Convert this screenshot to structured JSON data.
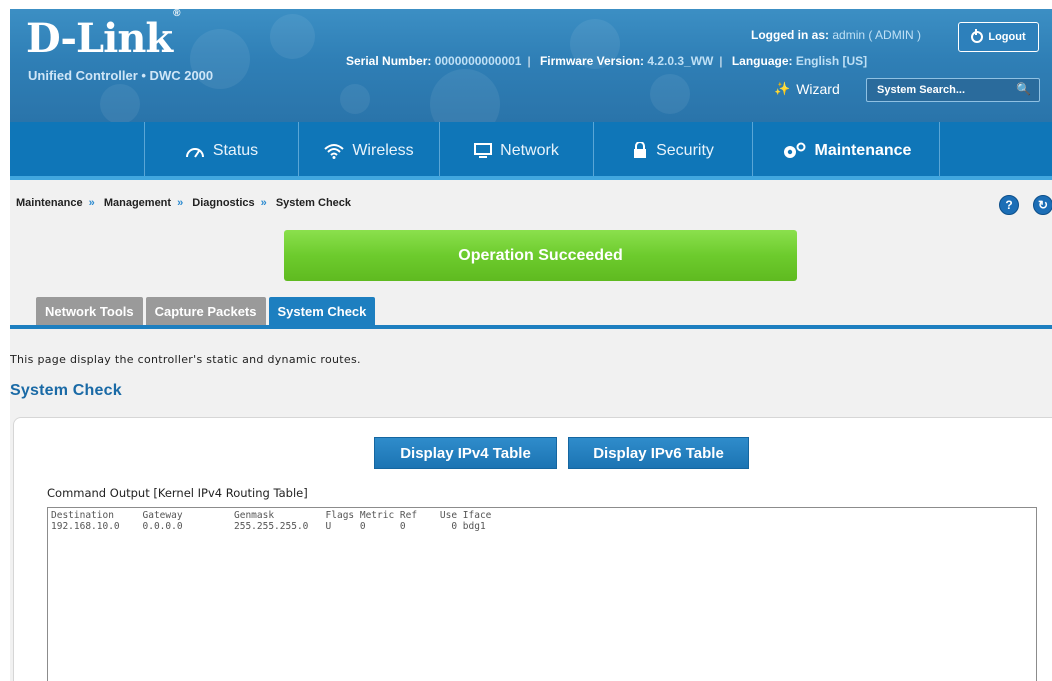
{
  "header": {
    "brand": "D-Link",
    "brand_mark": "®",
    "product": "Unified Controller • DWC 2000",
    "serial_label": "Serial Number:",
    "serial_value": "0000000000001",
    "firmware_label": "Firmware Version:",
    "firmware_value": "4.2.0.3_WW",
    "language_label": "Language:",
    "language_value": "English [US]",
    "logged_label": "Logged in as:",
    "logged_value": "admin ( ADMIN )",
    "logout_label": "Logout",
    "wizard_label": "Wizard",
    "search_placeholder": "System Search..."
  },
  "nav": {
    "items": [
      {
        "label": "Status",
        "icon": "gauge-icon"
      },
      {
        "label": "Wireless",
        "icon": "wifi-icon"
      },
      {
        "label": "Network",
        "icon": "monitor-icon"
      },
      {
        "label": "Security",
        "icon": "lock-icon"
      },
      {
        "label": "Maintenance",
        "icon": "gears-icon"
      }
    ],
    "active": "Maintenance"
  },
  "breadcrumb": [
    "Maintenance",
    "Management",
    "Diagnostics",
    "System Check"
  ],
  "breadcrumb_sep": "»",
  "alert": "Operation Succeeded",
  "tabs": [
    {
      "label": "Network Tools"
    },
    {
      "label": "Capture Packets"
    },
    {
      "label": "System Check"
    }
  ],
  "active_tab": "System Check",
  "description": "This page display the controller's static and dynamic routes.",
  "section_title": "System Check",
  "buttons": {
    "ipv4": "Display IPv4 Table",
    "ipv6": "Display IPv6 Table"
  },
  "command_output_label": "Command Output [Kernel IPv4 Routing Table]",
  "command_output": "Destination     Gateway         Genmask         Flags Metric Ref    Use Iface\n192.168.10.0    0.0.0.0         255.255.255.0   U     0      0        0 bdg1",
  "colors": {
    "header": "#2f7fb6",
    "nav": "#0f76b8",
    "success": "#6dcb2d",
    "accent": "#1d7fc0",
    "tab_inactive": "#9a9a9a"
  }
}
